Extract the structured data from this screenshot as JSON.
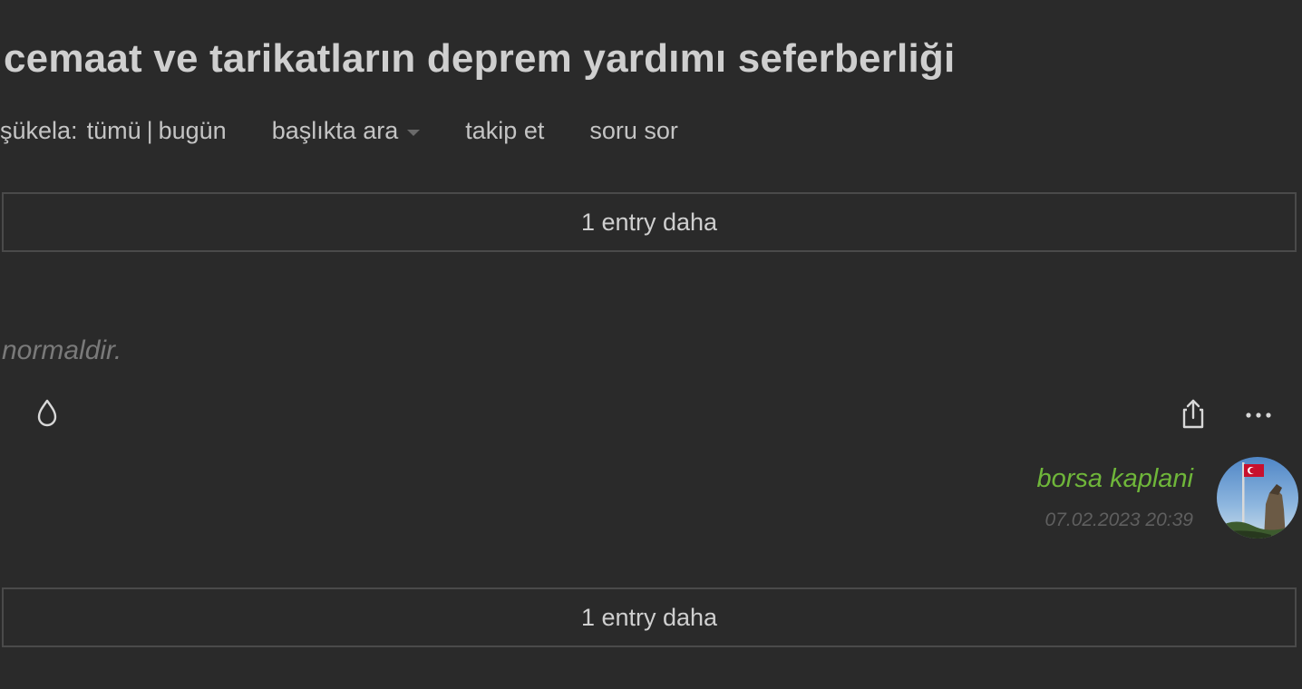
{
  "topic": {
    "title": "cemaat ve tarikatların deprem yardımı seferberliği"
  },
  "toolbar": {
    "sukela_label": "şükela:",
    "all_label": "tümü",
    "separator": "|",
    "today_label": "bugün",
    "search_label": "başlıkta ara",
    "follow_label": "takip et",
    "ask_label": "soru sor"
  },
  "more_entries": {
    "top_label": "1 entry daha",
    "bottom_label": "1 entry daha"
  },
  "entry": {
    "content": "normaldir.",
    "author": "borsa kaplani",
    "date": "07.02.2023 20:39"
  },
  "icons": {
    "favorite": "drop-icon",
    "share": "share-icon",
    "more": "ellipsis-icon",
    "search_dropdown": "caret-down-icon"
  },
  "colors": {
    "background": "#2a2a2a",
    "author": "#6fb63a",
    "muted_text": "#7a7a7a",
    "border": "#4a4a4a"
  }
}
